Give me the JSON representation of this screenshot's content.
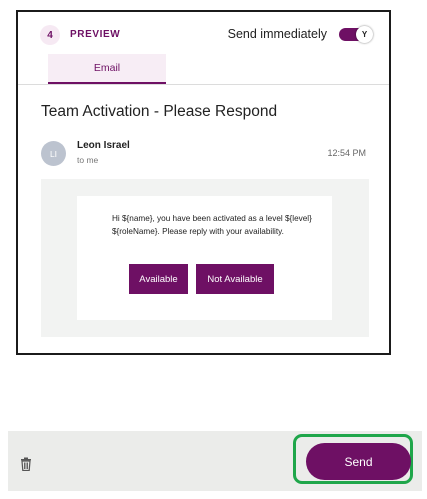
{
  "preview": {
    "step_number": "4",
    "step_label": "PREVIEW",
    "send_immediately_label": "Send immediately",
    "send_immediately_toggle": "Y",
    "tab_label": "Email"
  },
  "email": {
    "subject": "Team Activation - Please Respond",
    "avatar_initials": "LI",
    "sender_name": "Leon Israel",
    "recipient": "to me",
    "time": "12:54 PM",
    "message": "Hi ${name}, you have been activated as a level ${level} ${roleName}. Please reply with your availability.",
    "available_button": "Available",
    "not_available_button": "Not Available"
  },
  "footer": {
    "delete_icon": "trash-icon",
    "send_button": "Send"
  },
  "colors": {
    "accent": "#6e1064",
    "highlight": "#1fa64a"
  }
}
